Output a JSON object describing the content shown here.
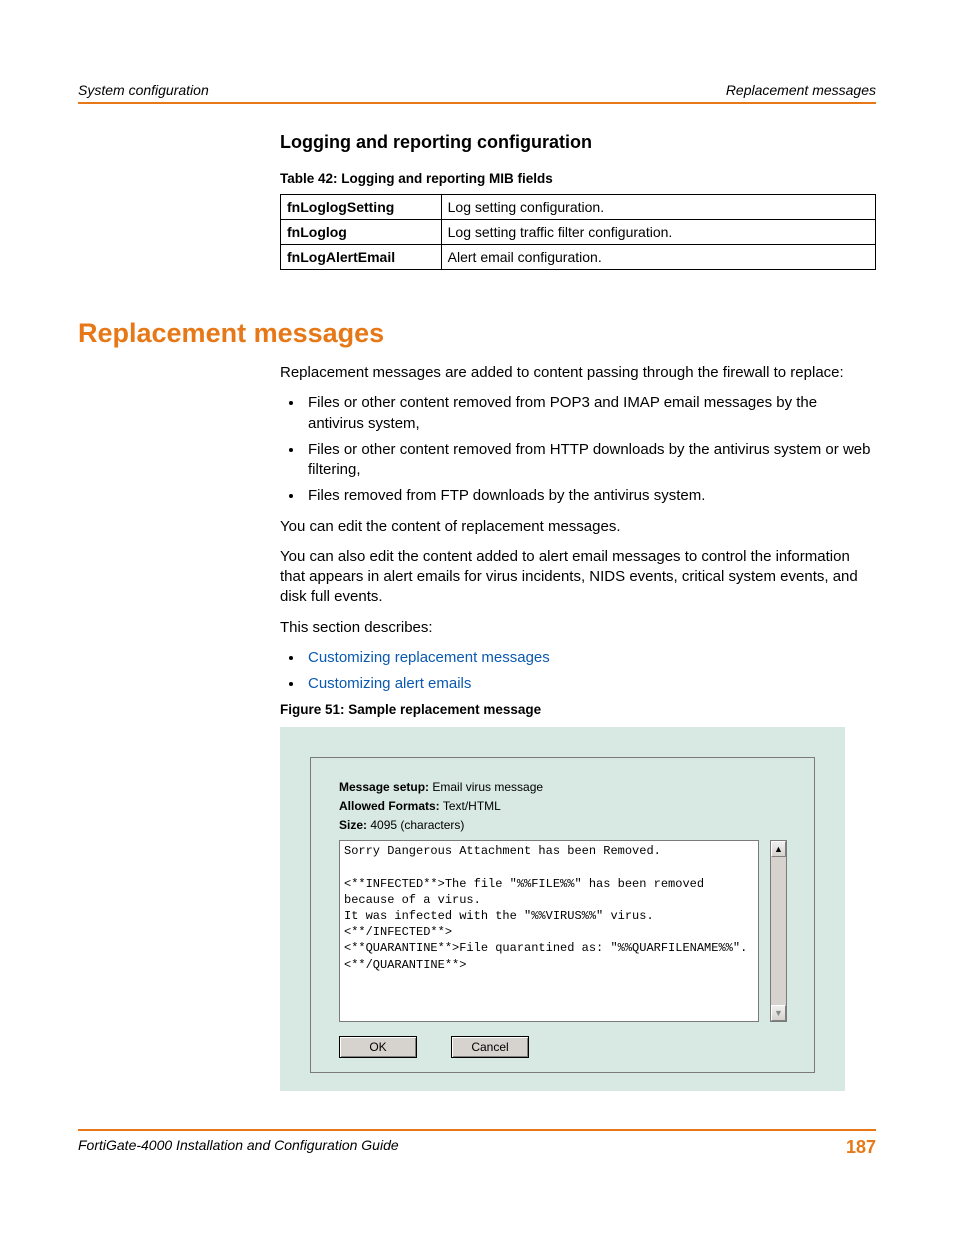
{
  "header": {
    "left": "System configuration",
    "right": "Replacement messages"
  },
  "sub_heading": "Logging and reporting configuration",
  "table": {
    "caption": "Table 42: Logging and reporting MIB fields",
    "rows": [
      {
        "field": "fnLoglogSetting",
        "desc": "Log setting configuration."
      },
      {
        "field": "fnLoglog",
        "desc": "Log setting traffic filter configuration."
      },
      {
        "field": "fnLogAlertEmail",
        "desc": "Alert email configuration."
      }
    ]
  },
  "section_title": "Replacement messages",
  "intro_para": "Replacement messages are added to content passing through the firewall to replace:",
  "reasons": [
    "Files or other content removed from POP3 and IMAP email messages by the antivirus system,",
    "Files or other content removed from HTTP downloads by the antivirus system or web filtering,",
    "Files removed from FTP downloads by the antivirus system."
  ],
  "para2": "You can edit the content of replacement messages.",
  "para3": "You can also edit the content added to alert email messages to control the information that appears in alert emails for virus incidents, NIDS events, critical system events, and disk full events.",
  "para4": "This section describes:",
  "links": [
    "Customizing replacement messages",
    "Customizing alert emails"
  ],
  "figure": {
    "caption": "Figure 51: Sample replacement message",
    "msg_setup_label": "Message setup:",
    "msg_setup_value": "Email virus message",
    "allowed_label": "Allowed Formats:",
    "allowed_value": "Text/HTML",
    "size_label": "Size:",
    "size_value": "4095 (characters)",
    "editor_text": "Sorry Dangerous Attachment has been Removed.\n\n<**INFECTED**>The file \"%%FILE%%\" has been removed because of a virus.\nIt was infected with the \"%%VIRUS%%\" virus.<**/INFECTED**>\n<**QUARANTINE**>File quarantined as: \"%%QUARFILENAME%%\".<**/QUARANTINE**>",
    "ok_label": "OK",
    "cancel_label": "Cancel"
  },
  "footer": {
    "guide": "FortiGate-4000 Installation and Configuration Guide",
    "page": "187"
  }
}
